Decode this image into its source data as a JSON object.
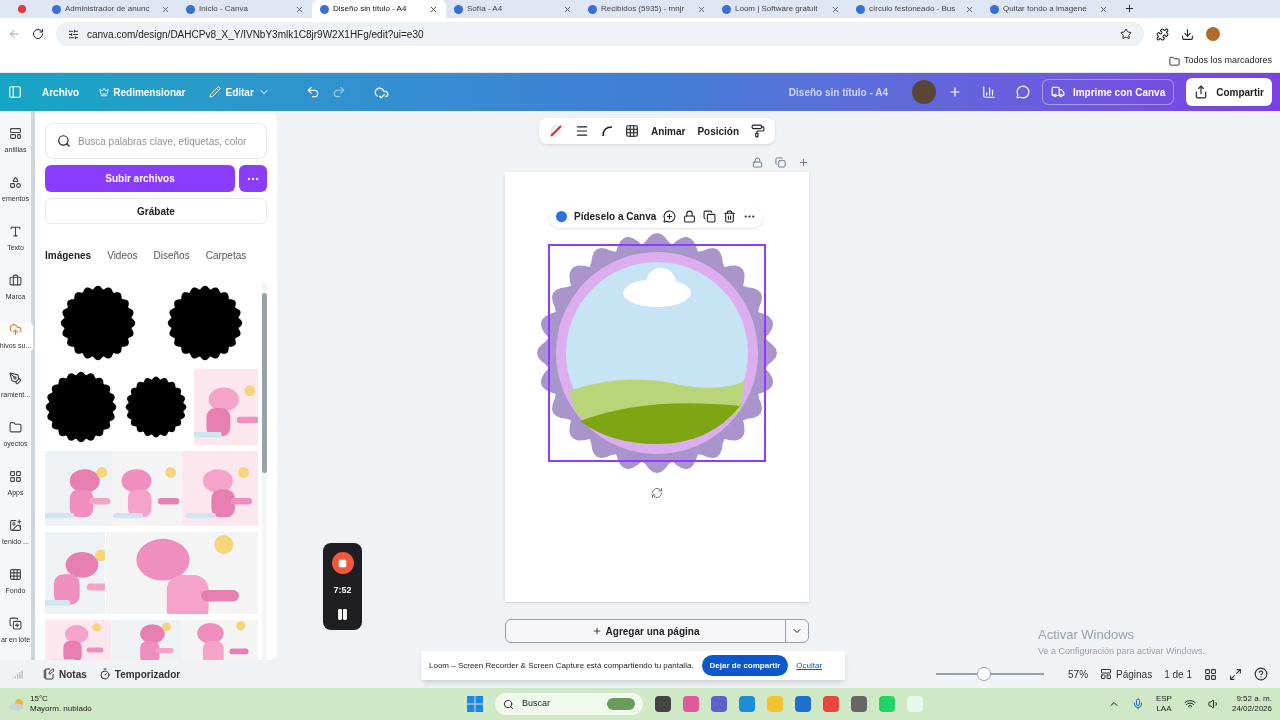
{
  "browser": {
    "tabs": [
      {
        "title": "Administrador de anunc",
        "selected": false
      },
      {
        "title": "Inicio - Canva",
        "selected": false
      },
      {
        "title": "Diseño sin título - A4",
        "selected": true
      },
      {
        "title": "Sofía - A4",
        "selected": false
      },
      {
        "title": "Recibidos (5935) - mnjr",
        "selected": false
      },
      {
        "title": "Loom | Software gratuit",
        "selected": false
      },
      {
        "title": "círculo festoneado - Bus",
        "selected": false
      },
      {
        "title": "Quitar fondo a imagene",
        "selected": false
      }
    ],
    "url": "canva.com/design/DAHCPv8_X_Y/IVNbY3mlk1C8jr9W2X1HFg/edit?ui=e30",
    "bookmarks": "Todos los marcadores"
  },
  "header": {
    "menu": [
      "Archivo",
      "Redimensionar",
      "Editar"
    ],
    "doc_title": "Diseño sin título - A4",
    "print_button": "Imprime con Canva",
    "share_button": "Compartir"
  },
  "rail": [
    {
      "label": "antillas",
      "selected": false
    },
    {
      "label": "ementos",
      "selected": false
    },
    {
      "label": "Texto",
      "selected": false
    },
    {
      "label": "Marca",
      "selected": false
    },
    {
      "label": "hivos su...",
      "selected": true
    },
    {
      "label": "ramient...",
      "selected": false
    },
    {
      "label": "oyectos",
      "selected": false
    },
    {
      "label": "Apps",
      "selected": false
    },
    {
      "label": "tenido ...",
      "selected": false
    },
    {
      "label": "Fondo",
      "selected": false
    },
    {
      "label": "ar en lote",
      "selected": false
    }
  ],
  "panel": {
    "search_placeholder": "Busca palabras clave, etiquetas, color",
    "upload_button": "Subir archivos",
    "record_button": "Grábate",
    "tabs": [
      {
        "label": "Imágenes",
        "selected": true
      },
      {
        "label": "Videos",
        "selected": false
      },
      {
        "label": "Diseños",
        "selected": false
      },
      {
        "label": "Carpetas",
        "selected": false
      }
    ],
    "images": [
      [
        {
          "kind": "scallop"
        },
        {
          "kind": "scallop"
        }
      ],
      [
        {
          "kind": "scallop"
        },
        {
          "kind": "scallop"
        },
        {
          "kind": "picture"
        }
      ],
      [
        {
          "kind": "picture"
        },
        {
          "kind": "picture"
        },
        {
          "kind": "picture"
        }
      ],
      [
        {
          "kind": "picture"
        },
        {
          "kind": "picture"
        }
      ],
      [
        {
          "kind": "picture"
        },
        {
          "kind": "picture"
        },
        {
          "kind": "picture"
        }
      ]
    ]
  },
  "toolbar": {
    "actions": [
      "Animar",
      "Posición"
    ]
  },
  "ai_pill": "Pídeselo a Canva",
  "add_page": "Agregar una página",
  "recorder": {
    "time": "7:52"
  },
  "bottom": {
    "notes": "Notas",
    "timer": "Temporizador",
    "zoom": {
      "level": 0.44,
      "reading": "57%"
    },
    "pages": "Páginas",
    "page_count": "1 de 1"
  },
  "share_bar": {
    "message": "Loom – Screen Recorder & Screen Capture está compartiendo tu pantalla.",
    "stop": "Dejar de compartir",
    "hide": "Ocultar"
  },
  "activation": {
    "title": "Activar Windows",
    "subtitle": "Ve a Configuración para activar Windows."
  },
  "taskbar": {
    "temp": "15°C",
    "weather": "Mayorm. nublado",
    "search": "Buscar",
    "lang": "ESP",
    "region": "LAA",
    "time": "9:52 a. m.",
    "date": "24/02/2026"
  }
}
